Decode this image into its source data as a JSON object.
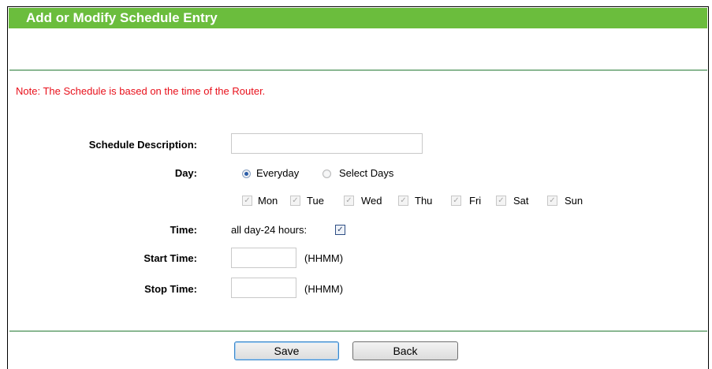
{
  "title": "Add or Modify Schedule Entry",
  "note": "Note: The Schedule is based on the time of the Router.",
  "form": {
    "description_label": "Schedule Description:",
    "description_value": "",
    "day_label": "Day:",
    "day_options": {
      "everyday": "Everyday",
      "select_days": "Select Days",
      "selected": "Everyday"
    },
    "days": [
      "Mon",
      "Tue",
      "Wed",
      "Thu",
      "Fri",
      "Sat",
      "Sun"
    ],
    "time_label": "Time:",
    "all_day_label": "all day-24 hours:",
    "all_day_checked": true,
    "start_label": "Start Time:",
    "start_value": "",
    "start_hint": "(HHMM)",
    "stop_label": "Stop Time:",
    "stop_value": "",
    "stop_hint": "(HHMM)"
  },
  "buttons": {
    "save": "Save",
    "back": "Back"
  },
  "colors": {
    "header": "#6bbd3d",
    "note": "#e8101b",
    "divider": "#8ab892"
  },
  "icons": {
    "checkmark": "✓"
  }
}
